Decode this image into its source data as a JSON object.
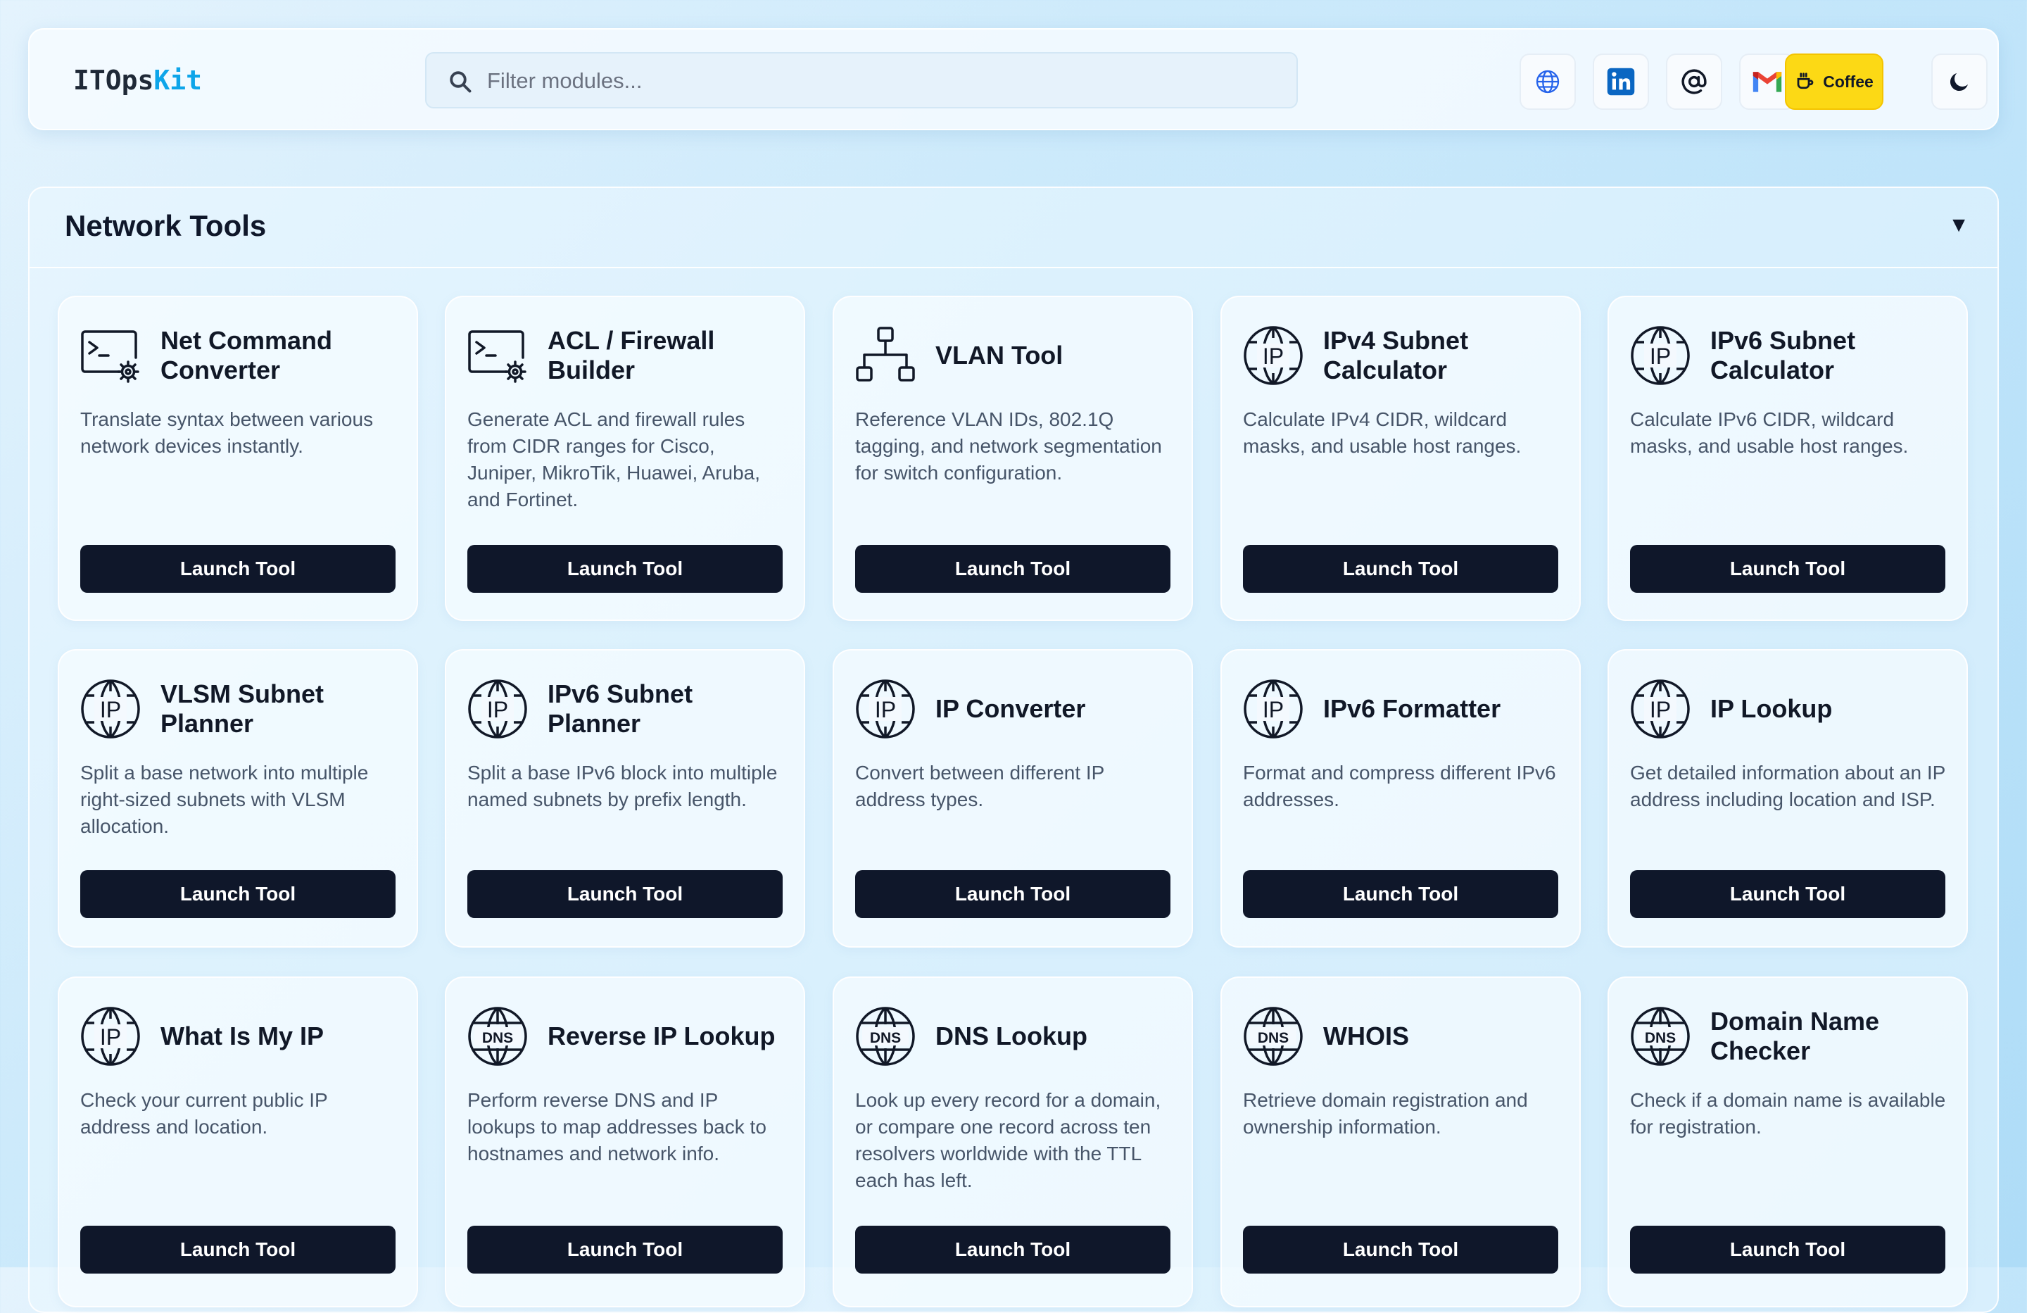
{
  "header": {
    "logo_main": "ITOps",
    "logo_accent": "Kit",
    "search_placeholder": "Filter modules...",
    "coffee_label": "Coffee",
    "icons": [
      "globe-icon",
      "linkedin-icon",
      "at-sign-icon",
      "gmail-icon",
      "coffee-icon",
      "moon-icon"
    ]
  },
  "section": {
    "title": "Network Tools",
    "toggle": "▼"
  },
  "colors": {
    "accent": "#0ea5e9",
    "button": "#0f172a",
    "coffee": "#fcd915"
  },
  "cards": [
    {
      "icon": "terminal-gear-icon",
      "title": "Net Command Converter",
      "desc": "Translate syntax between various network devices instantly.",
      "button": "Launch Tool"
    },
    {
      "icon": "terminal-gear-icon",
      "title": "ACL / Firewall Builder",
      "desc": "Generate ACL and firewall rules from CIDR ranges for Cisco, Juniper, MikroTik, Huawei, Aruba, and Fortinet.",
      "button": "Launch Tool"
    },
    {
      "icon": "network-topology-icon",
      "title": "VLAN Tool",
      "desc": "Reference VLAN IDs, 802.1Q tagging, and network segmentation for switch configuration.",
      "button": "Launch Tool"
    },
    {
      "icon": "ip-globe-icon",
      "title": "IPv4 Subnet Calculator",
      "desc": "Calculate IPv4 CIDR, wildcard masks, and usable host ranges.",
      "button": "Launch Tool"
    },
    {
      "icon": "ip-globe-icon",
      "title": "IPv6 Subnet Calculator",
      "desc": "Calculate IPv6 CIDR, wildcard masks, and usable host ranges.",
      "button": "Launch Tool"
    },
    {
      "icon": "ip-globe-icon",
      "title": "VLSM Subnet Planner",
      "desc": "Split a base network into multiple right-sized subnets with VLSM allocation.",
      "button": "Launch Tool"
    },
    {
      "icon": "ip-globe-icon",
      "title": "IPv6 Subnet Planner",
      "desc": "Split a base IPv6 block into multiple named subnets by prefix length.",
      "button": "Launch Tool"
    },
    {
      "icon": "ip-globe-icon",
      "title": "IP Converter",
      "desc": "Convert between different IP address types.",
      "button": "Launch Tool"
    },
    {
      "icon": "ip-globe-icon",
      "title": "IPv6 Formatter",
      "desc": "Format and compress different IPv6 addresses.",
      "button": "Launch Tool"
    },
    {
      "icon": "ip-globe-icon",
      "title": "IP Lookup",
      "desc": "Get detailed information about an IP address including location and ISP.",
      "button": "Launch Tool"
    },
    {
      "icon": "ip-globe-icon",
      "title": "What Is My IP",
      "desc": "Check your current public IP address and location.",
      "button": "Launch Tool"
    },
    {
      "icon": "dns-globe-icon",
      "title": "Reverse IP Lookup",
      "desc": "Perform reverse DNS and IP lookups to map addresses back to hostnames and network info.",
      "button": "Launch Tool"
    },
    {
      "icon": "dns-globe-icon",
      "title": "DNS Lookup",
      "desc": "Look up every record for a domain, or compare one record across ten resolvers worldwide with the TTL each has left.",
      "button": "Launch Tool"
    },
    {
      "icon": "dns-globe-icon",
      "title": "WHOIS",
      "desc": "Retrieve domain registration and ownership information.",
      "button": "Launch Tool"
    },
    {
      "icon": "dns-globe-icon",
      "title": "Domain Name Checker",
      "desc": "Check if a domain name is available for registration.",
      "button": "Launch Tool"
    }
  ]
}
